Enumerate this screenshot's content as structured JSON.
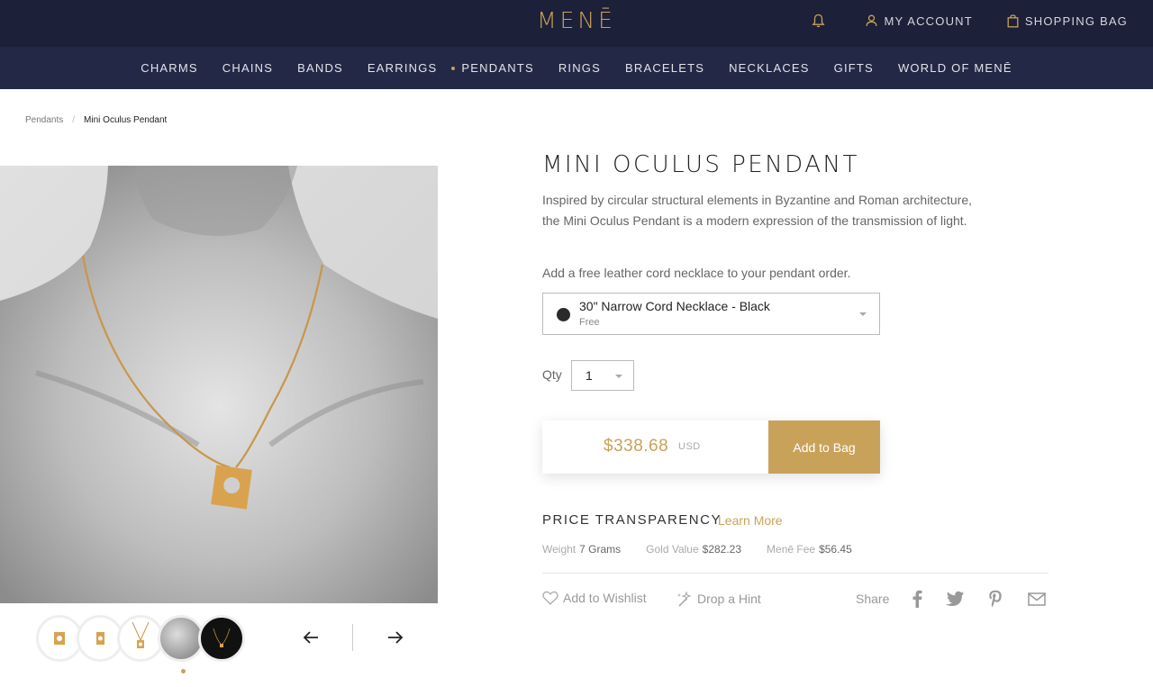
{
  "header": {
    "logo": "MENĒ",
    "account_label": "MY ACCOUNT",
    "bag_label": "SHOPPING BAG",
    "icons": [
      "bell-icon",
      "user-icon",
      "bag-icon"
    ]
  },
  "nav": {
    "items": [
      "CHARMS",
      "CHAINS",
      "BANDS",
      "EARRINGS",
      "PENDANTS",
      "RINGS",
      "BRACELETS",
      "NECKLACES",
      "GIFTS",
      "WORLD OF MENĒ"
    ],
    "active": "PENDANTS"
  },
  "breadcrumb": {
    "parent": "Pendants",
    "separator": "/",
    "current": "Mini Oculus Pendant"
  },
  "product": {
    "title": "MINI OCULUS PENDANT",
    "description": "Inspired by circular structural elements in Byzantine and Roman architecture, the Mini Oculus Pendant is a modern expression of the transmission of light.",
    "cord_note": "Add a free leather cord necklace to your pendant order.",
    "cord_option": {
      "name": "30\" Narrow Cord Necklace - Black",
      "price": "Free",
      "swatch_color": "#2a2a2a"
    },
    "qty_label": "Qty",
    "qty_value": "1",
    "price": "$338.68",
    "currency": "USD",
    "add_to_bag": "Add to Bag"
  },
  "transparency": {
    "title": "PRICE TRANSPARENCY",
    "learn_more": "Learn More",
    "weight_label": "Weight",
    "weight_value": "7 Grams",
    "gold_label": "Gold Value",
    "gold_value": "$282.23",
    "fee_label": "Menē Fee",
    "fee_value": "$56.45"
  },
  "actions": {
    "wishlist": "Add to Wishlist",
    "hint": "Drop a Hint",
    "share": "Share",
    "share_icons": [
      "facebook-icon",
      "twitter-icon",
      "pinterest-icon",
      "email-icon"
    ]
  },
  "gallery": {
    "thumbnails": [
      "thumb-pendant-front",
      "thumb-pendant-side",
      "thumb-pendant-chain",
      "thumb-model-photo",
      "thumb-pendant-dark"
    ]
  },
  "colors": {
    "gold": "#c9a25a",
    "navy": "#1c2038",
    "navy_secondary": "#232846"
  }
}
